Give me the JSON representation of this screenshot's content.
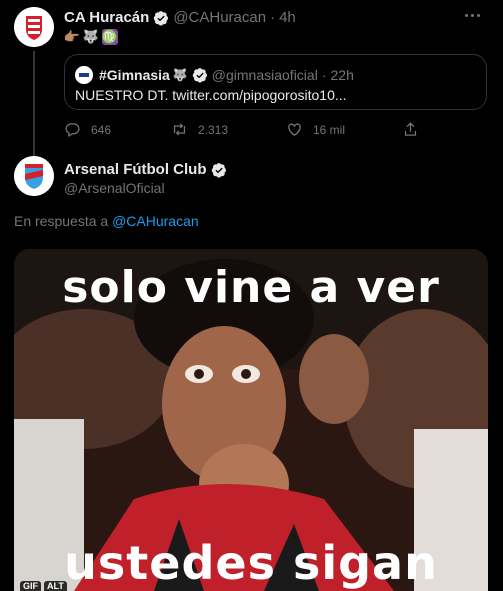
{
  "tweet1": {
    "name": "CA Huracán",
    "handle": "@CAHuracan",
    "time": "4h",
    "emojis": [
      "👉🏽",
      "🐺",
      "♍"
    ],
    "quote": {
      "name": "#Gimnasia",
      "name_emoji": "🐺",
      "handle": "@gimnasiaoficial",
      "time": "22h",
      "text": "NUESTRO DT. twitter.com/pipogorosito10..."
    },
    "actions": {
      "replies": "646",
      "retweets": "2.313",
      "likes": "16 mil"
    }
  },
  "tweet2": {
    "name": "Arsenal Fútbol Club",
    "handle": "@ArsenalOficial",
    "reply_prefix": "En respuesta a",
    "reply_to": "@CAHuracan",
    "media": {
      "caption_top": "solo vine a ver",
      "caption_bottom": "ustedes sigan",
      "gif_badge": "GIF",
      "alt_badge": "ALT"
    }
  },
  "colors": {
    "background": "#000000",
    "text": "#e7e9ea",
    "muted": "#71767b",
    "accent": "#1d9bf0",
    "border": "#2f3336"
  }
}
